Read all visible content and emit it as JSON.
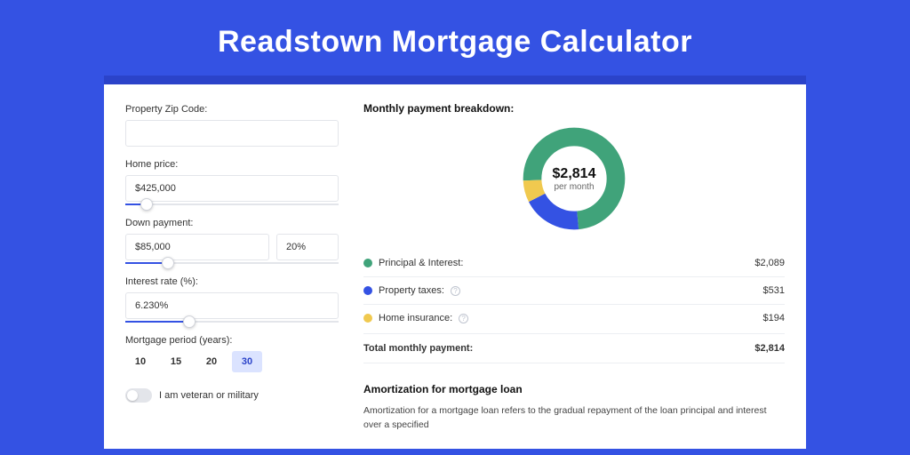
{
  "page": {
    "title": "Readstown Mortgage Calculator"
  },
  "form": {
    "zip_label": "Property Zip Code:",
    "zip_value": "",
    "home_price_label": "Home price:",
    "home_price_value": "$425,000",
    "home_price_slider_pct": 10,
    "down_payment_label": "Down payment:",
    "down_payment_value": "$85,000",
    "down_payment_pct_value": "20%",
    "down_payment_slider_pct": 20,
    "interest_label": "Interest rate (%):",
    "interest_value": "6.230%",
    "interest_slider_pct": 30,
    "period_label": "Mortgage period (years):",
    "period_options": [
      "10",
      "15",
      "20",
      "30"
    ],
    "period_selected": "30",
    "veteran_label": "I am veteran or military"
  },
  "breakdown": {
    "title": "Monthly payment breakdown:",
    "center_value": "$2,814",
    "center_sub": "per month",
    "items": [
      {
        "label": "Principal & Interest:",
        "value": "$2,089",
        "color": "green",
        "info": false
      },
      {
        "label": "Property taxes:",
        "value": "$531",
        "color": "blue",
        "info": true
      },
      {
        "label": "Home insurance:",
        "value": "$194",
        "color": "yellow",
        "info": true
      }
    ],
    "total_label": "Total monthly payment:",
    "total_value": "$2,814"
  },
  "amort": {
    "title": "Amortization for mortgage loan",
    "text": "Amortization for a mortgage loan refers to the gradual repayment of the loan principal and interest over a specified"
  },
  "chart_data": {
    "type": "pie",
    "title": "Monthly payment breakdown",
    "series": [
      {
        "name": "Principal & Interest",
        "value": 2089,
        "color": "#40a37a"
      },
      {
        "name": "Property taxes",
        "value": 531,
        "color": "#3452e3"
      },
      {
        "name": "Home insurance",
        "value": 194,
        "color": "#f0c94f"
      }
    ],
    "total": 2814,
    "center_label": "$2,814 per month"
  }
}
